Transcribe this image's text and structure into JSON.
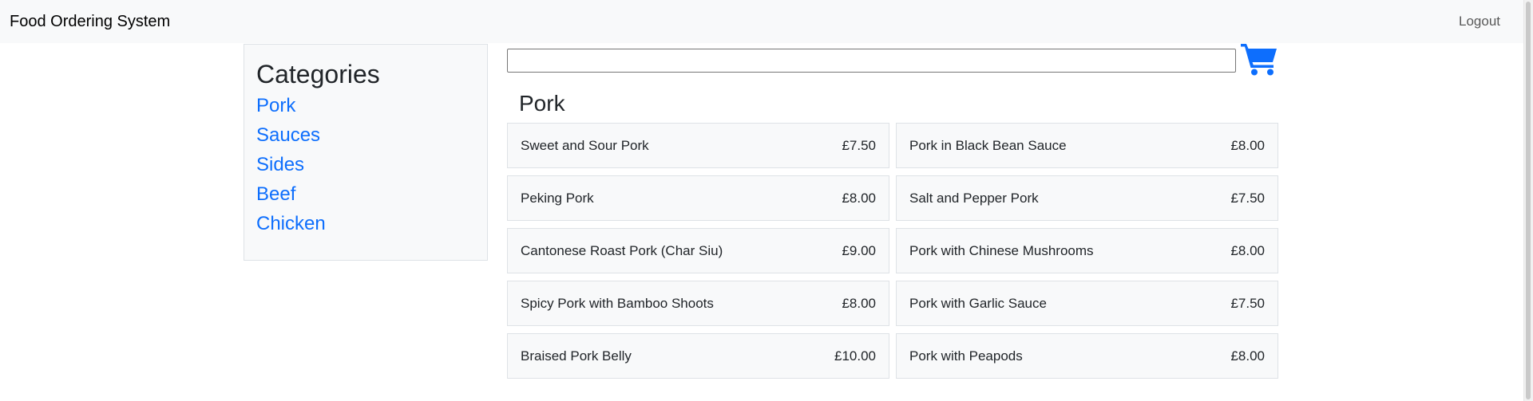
{
  "navbar": {
    "brand": "Food Ordering System",
    "logout_label": "Logout"
  },
  "sidebar": {
    "title": "Categories",
    "categories": [
      {
        "label": "Pork"
      },
      {
        "label": "Sauces"
      },
      {
        "label": "Sides"
      },
      {
        "label": "Beef"
      },
      {
        "label": "Chicken"
      }
    ]
  },
  "search": {
    "value": "",
    "placeholder": ""
  },
  "cart": {
    "icon": "shopping-cart-icon",
    "color": "#0d6efd"
  },
  "main": {
    "section_title": "Pork",
    "items": [
      {
        "name": "Sweet and Sour Pork",
        "price": "£7.50"
      },
      {
        "name": "Pork in Black Bean Sauce",
        "price": "£8.00"
      },
      {
        "name": "Peking Pork",
        "price": "£8.00"
      },
      {
        "name": "Salt and Pepper Pork",
        "price": "£7.50"
      },
      {
        "name": "Cantonese Roast Pork (Char Siu)",
        "price": "£9.00"
      },
      {
        "name": "Pork with Chinese Mushrooms",
        "price": "£8.00"
      },
      {
        "name": "Spicy Pork with Bamboo Shoots",
        "price": "£8.00"
      },
      {
        "name": "Pork with Garlic Sauce",
        "price": "£7.50"
      },
      {
        "name": "Braised Pork Belly",
        "price": "£10.00"
      },
      {
        "name": "Pork with Peapods",
        "price": "£8.00"
      }
    ]
  },
  "colors": {
    "link": "#0d6efd",
    "panel_bg": "#f8f9fa",
    "border": "#dee2e6"
  }
}
